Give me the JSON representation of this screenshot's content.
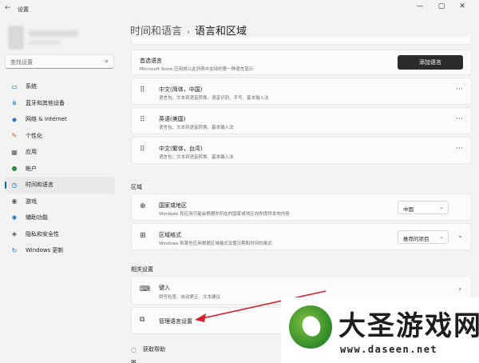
{
  "window": {
    "title": "设置",
    "back": "←",
    "min": "—",
    "max": "▢",
    "close": "✕"
  },
  "sidebar": {
    "search_placeholder": "查找设置",
    "items": [
      {
        "label": "系统",
        "icon": "monitor-icon",
        "glyph": "▭"
      },
      {
        "label": "蓝牙和其他设备",
        "icon": "bluetooth-icon",
        "glyph": "ʙ"
      },
      {
        "label": "网络 & Internet",
        "icon": "wifi-icon",
        "glyph": "◆"
      },
      {
        "label": "个性化",
        "icon": "brush-icon",
        "glyph": "✎"
      },
      {
        "label": "应用",
        "icon": "apps-icon",
        "glyph": "▦"
      },
      {
        "label": "帐户",
        "icon": "person-icon",
        "glyph": "●"
      },
      {
        "label": "时间和语言",
        "icon": "globe-clock-icon",
        "glyph": "◷",
        "selected": true
      },
      {
        "label": "游戏",
        "icon": "gamepad-icon",
        "glyph": "◉"
      },
      {
        "label": "辅助功能",
        "icon": "accessibility-icon",
        "glyph": "✱"
      },
      {
        "label": "隐私和安全性",
        "icon": "shield-icon",
        "glyph": "◈"
      },
      {
        "label": "Windows 更新",
        "icon": "update-icon",
        "glyph": "↻"
      }
    ]
  },
  "breadcrumb": {
    "parent": "时间和语言",
    "sep": "›",
    "current": "语言和区域"
  },
  "preferred": {
    "title": "首选语言",
    "desc": "Microsoft Store 应用将以此列表中支持的第一种语言显示",
    "button": "添加语言"
  },
  "languages": [
    {
      "name": "中文(简体，中国)",
      "desc": "语言包、文本到语音转换、语音识别、手写、基本输入法"
    },
    {
      "name": "英语(美国)",
      "desc": "语言包、文本到语音转换、基本输入法"
    },
    {
      "name": "中文(繁体，台湾)",
      "desc": "语言包、文本到语音转换、基本输入法"
    }
  ],
  "region": {
    "label": "区域",
    "country": {
      "title": "国家或地区",
      "desc": "Windows 和应用可能会根据你所在的国家或地区向你提供本地内容",
      "value": "中国"
    },
    "format": {
      "title": "区域格式",
      "desc": "Windows 和某些应用根据区域格式设置日期和时间的格式",
      "value": "推荐的项目"
    }
  },
  "related": {
    "label": "相关设置",
    "typing": {
      "title": "键入",
      "desc": "拼写检查、自动更正、文本建议"
    },
    "manage": {
      "title": "管理语言设置"
    }
  },
  "help": {
    "get_help": "获取帮助"
  },
  "watermark": {
    "title": "大圣游戏网",
    "url": "www.daseen.net"
  },
  "colors": {
    "accent": "#0067c0",
    "arrow": "#d9212a"
  }
}
